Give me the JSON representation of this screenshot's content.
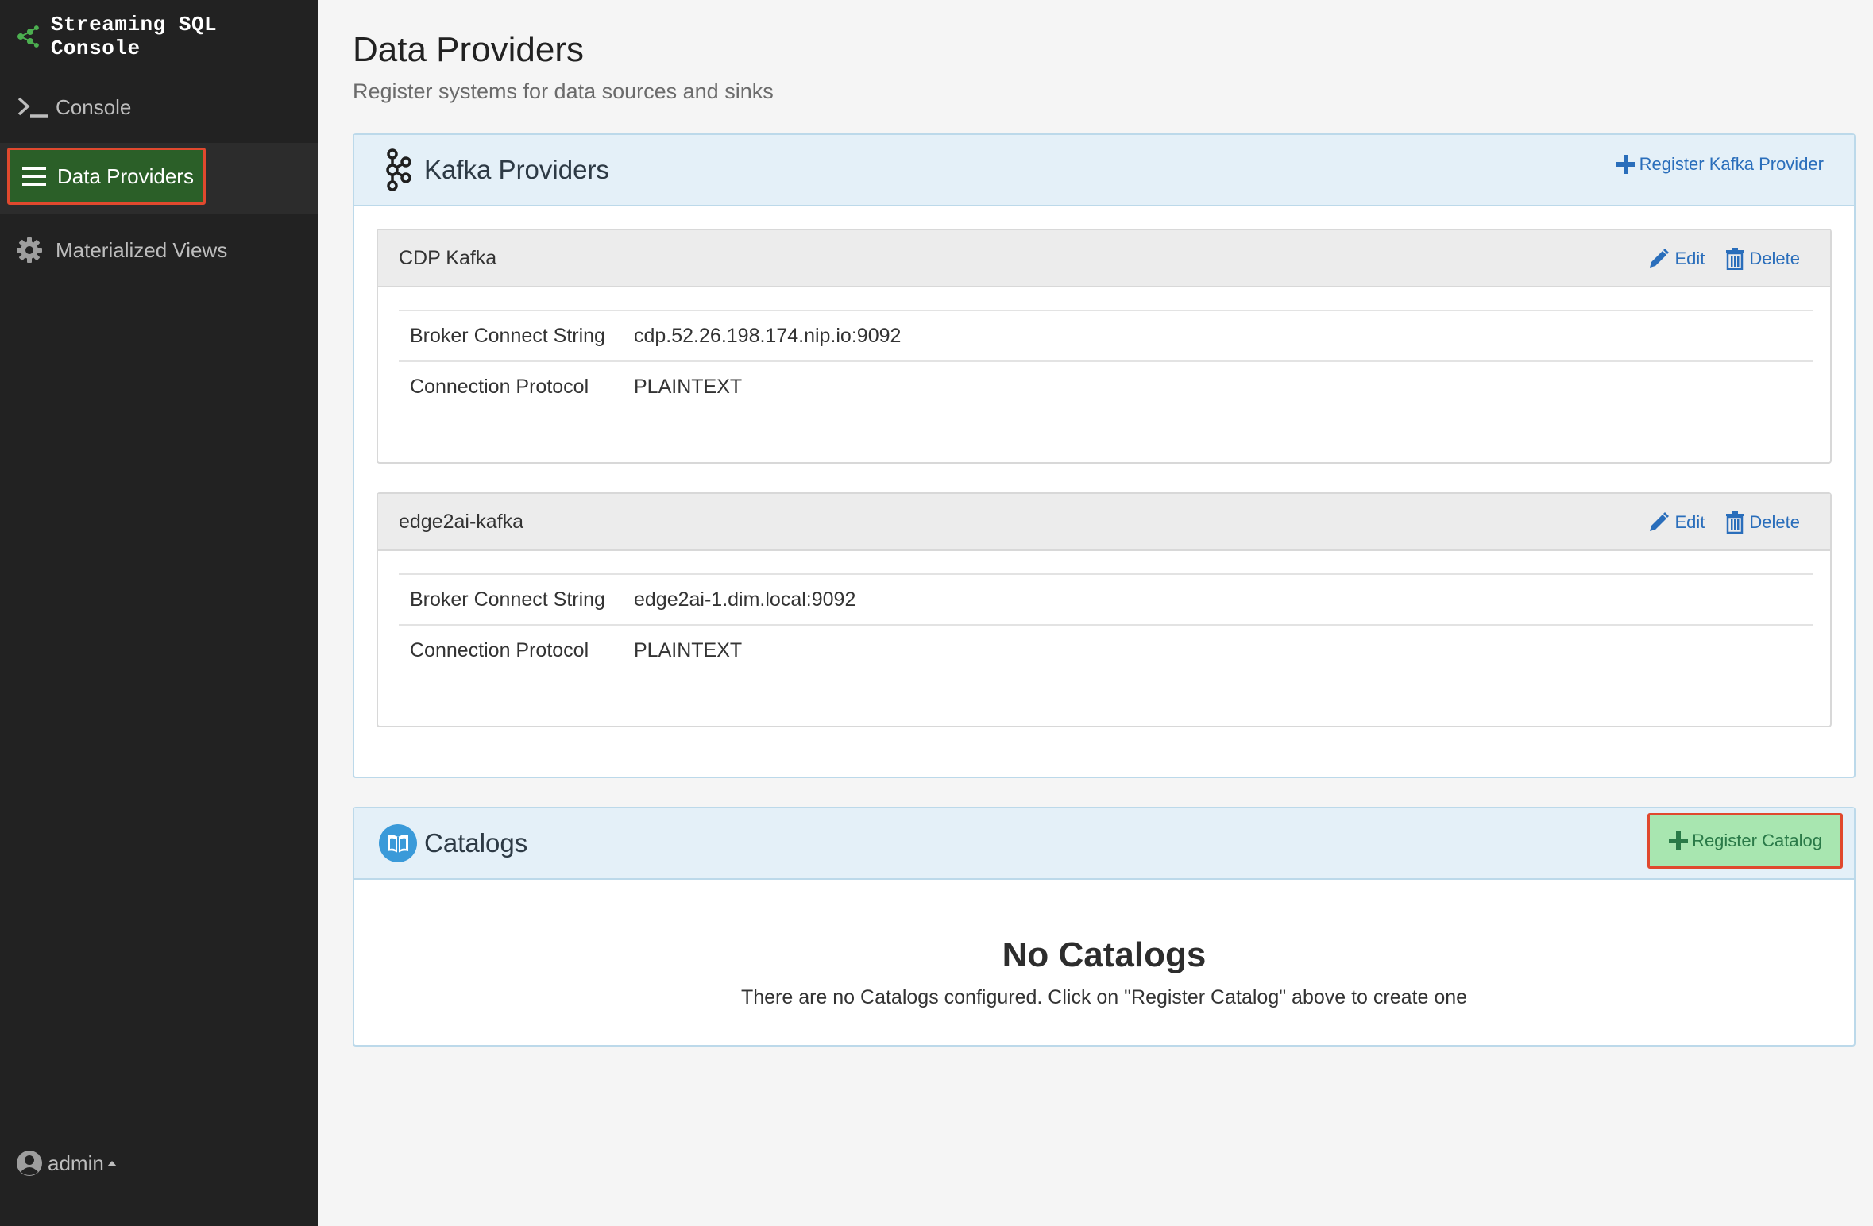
{
  "app": {
    "title": "Streaming SQL Console"
  },
  "sidebar": {
    "items": [
      {
        "label": "Console",
        "icon": "terminal-icon"
      },
      {
        "label": "Data Providers",
        "icon": "list-icon",
        "active": true
      },
      {
        "label": "Materialized Views",
        "icon": "gear-icon"
      }
    ],
    "user": {
      "name": "admin",
      "icon": "user-circle-icon"
    }
  },
  "page": {
    "title": "Data Providers",
    "subtitle": "Register systems for data sources and sinks"
  },
  "kafka": {
    "title": "Kafka Providers",
    "action_label": "Register Kafka Provider",
    "edit_label": "Edit",
    "delete_label": "Delete",
    "providers": [
      {
        "name": "CDP Kafka",
        "rows": [
          {
            "key": "Broker Connect String",
            "value": "cdp.52.26.198.174.nip.io:9092"
          },
          {
            "key": "Connection Protocol",
            "value": "PLAINTEXT"
          }
        ]
      },
      {
        "name": "edge2ai-kafka",
        "rows": [
          {
            "key": "Broker Connect String",
            "value": "edge2ai-1.dim.local:9092"
          },
          {
            "key": "Connection Protocol",
            "value": "PLAINTEXT"
          }
        ]
      }
    ]
  },
  "catalogs": {
    "title": "Catalogs",
    "action_label": "Register Catalog",
    "empty_title": "No Catalogs",
    "empty_text": "There are no Catalogs configured. Click on \"Register Catalog\" above to create one"
  },
  "colors": {
    "sidebar_bg": "#222222",
    "active_bg": "#2b5f28",
    "highlight_border": "#e0492e",
    "link": "#2a6ebb",
    "panel_heading_bg": "#e4f0f8",
    "register_catalog_bg": "#a8e6b0"
  }
}
